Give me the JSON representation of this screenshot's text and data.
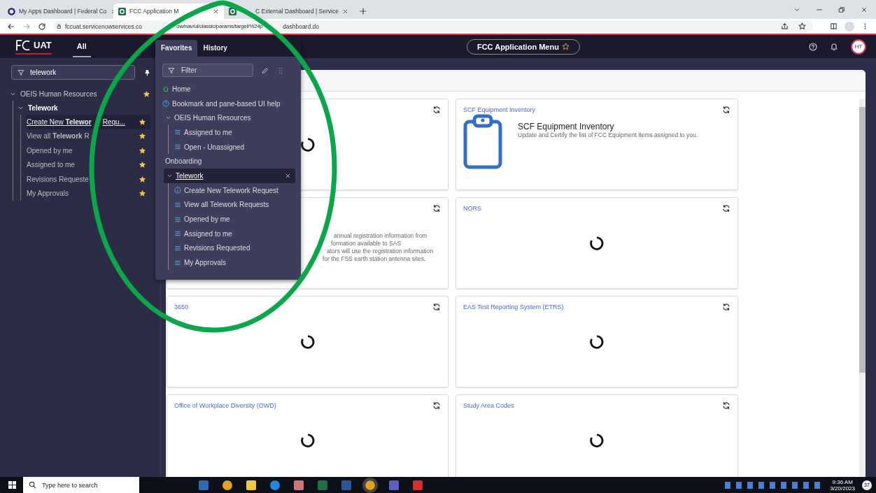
{
  "browser": {
    "tabs": [
      {
        "title": "My Apps Dashboard | Federal Co",
        "selected": false,
        "kind": "ring"
      },
      {
        "title": "FCC Application M",
        "selected": true,
        "kind": "app"
      },
      {
        "title": "C External Dashboard | Service",
        "selected": false,
        "kind": "app"
      }
    ],
    "url": "fccuat.servicenowservices.co",
    "url_tail": "ow/nav/ui/classic/params/target/%24p",
    "url_end": "dashboard.do"
  },
  "header": {
    "brand": "UAT",
    "nav_tabs": [
      {
        "label": "All",
        "selected": true
      }
    ],
    "app_menu": "FCC Application Menu",
    "avatar": "HT"
  },
  "left_nav": {
    "filter": "telework",
    "tree": [
      {
        "label": "OEIS Human Resources",
        "expanded": true,
        "starred": true,
        "children": [
          {
            "label": "Telework",
            "expanded": true,
            "children": [
              {
                "label": "Create New **Telewor**",
                "label_tail": "Requ...",
                "selected": true,
                "starred": true
              },
              {
                "label": "View all **Telework** R",
                "selected": false,
                "starred": true
              },
              {
                "label": "Opened by me",
                "selected": false,
                "starred": true
              },
              {
                "label": "Assigned to me",
                "selected": false,
                "starred": true
              },
              {
                "label": "Revisions Requeste",
                "selected": false,
                "starred": true
              },
              {
                "label": "My Approvals",
                "selected": false,
                "starred": true
              }
            ]
          }
        ]
      }
    ]
  },
  "favorites": {
    "tabs": [
      {
        "label": "Favorites",
        "selected": true
      },
      {
        "label": "History",
        "selected": false
      }
    ],
    "filter_placeholder": "Filter",
    "items": [
      {
        "kind": "home",
        "label": "Home"
      },
      {
        "kind": "help",
        "label": "Bookmark and pane-based UI help"
      },
      {
        "kind": "group",
        "label": "OEIS Human Resources",
        "expanded": true,
        "selected": false,
        "children": [
          {
            "kind": "list",
            "label": "Assigned to me"
          },
          {
            "kind": "list",
            "label": "Open - Unassigned"
          }
        ]
      },
      {
        "kind": "label",
        "label": "Onboarding"
      },
      {
        "kind": "group",
        "label": "Telework",
        "expanded": true,
        "selected": true,
        "children": [
          {
            "kind": "info",
            "label": "Create New Telework Request"
          },
          {
            "kind": "list",
            "label": "View all Telework Requests"
          },
          {
            "kind": "list",
            "label": "Opened by me"
          },
          {
            "kind": "list",
            "label": "Assigned to me"
          },
          {
            "kind": "list",
            "label": "Revisions Requested"
          },
          {
            "kind": "list",
            "label": "My Approvals"
          }
        ]
      }
    ]
  },
  "cards": [
    {
      "kind": "loading"
    },
    {
      "kind": "app",
      "title": "SCF Equipment Inventory",
      "heading": "SCF Equipment Inventory",
      "description": "Update and Certify the list of FCC Equipment items assigned to you."
    },
    {
      "kind": "text",
      "lines": [
        "annual registration information from",
        "formation available to SAS",
        "ators will use the registration information",
        "for the FSS earth station antenna sites."
      ]
    },
    {
      "kind": "loading",
      "title": "NORS"
    },
    {
      "kind": "loading",
      "title": "3650"
    },
    {
      "kind": "loading",
      "title": "EAS Test Reporting System (ETRS)"
    },
    {
      "kind": "loading",
      "title": "Office of Workplace Diversity (OWD)"
    },
    {
      "kind": "loading",
      "title": "Study Area Codes"
    }
  ],
  "taskbar": {
    "search_placeholder": "Type here to search",
    "time": "9:36 AM",
    "date": "3/20/2023",
    "notifications": "37"
  }
}
